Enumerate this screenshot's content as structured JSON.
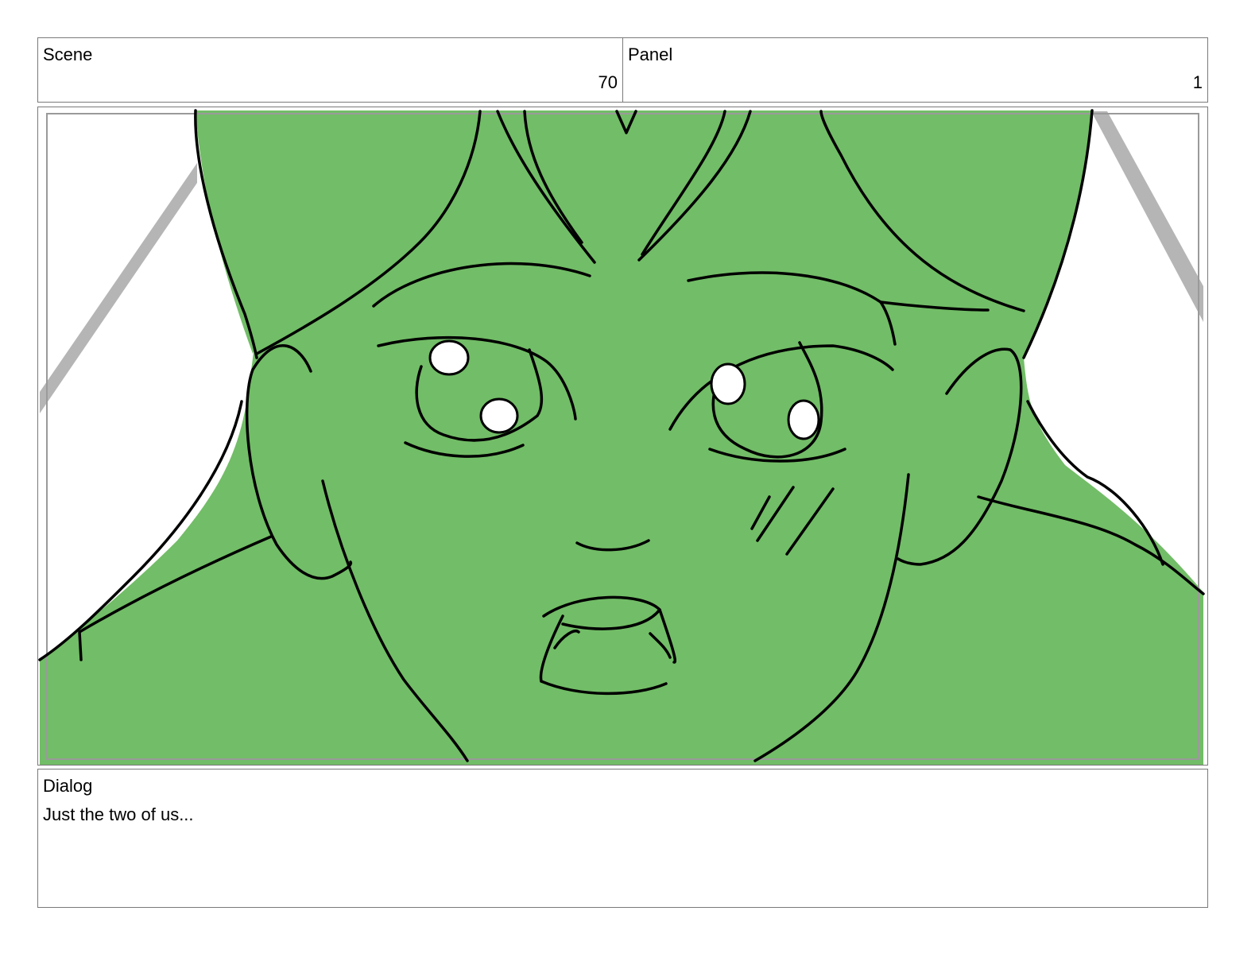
{
  "header": {
    "scene_label": "Scene",
    "scene_value": "70",
    "panel_label": "Panel",
    "panel_value": "1"
  },
  "frame": {
    "fill_color": "#72bd67",
    "line_color": "#000000",
    "background": "#ffffff"
  },
  "dialog": {
    "label": "Dialog",
    "text": "Just the two of us..."
  }
}
